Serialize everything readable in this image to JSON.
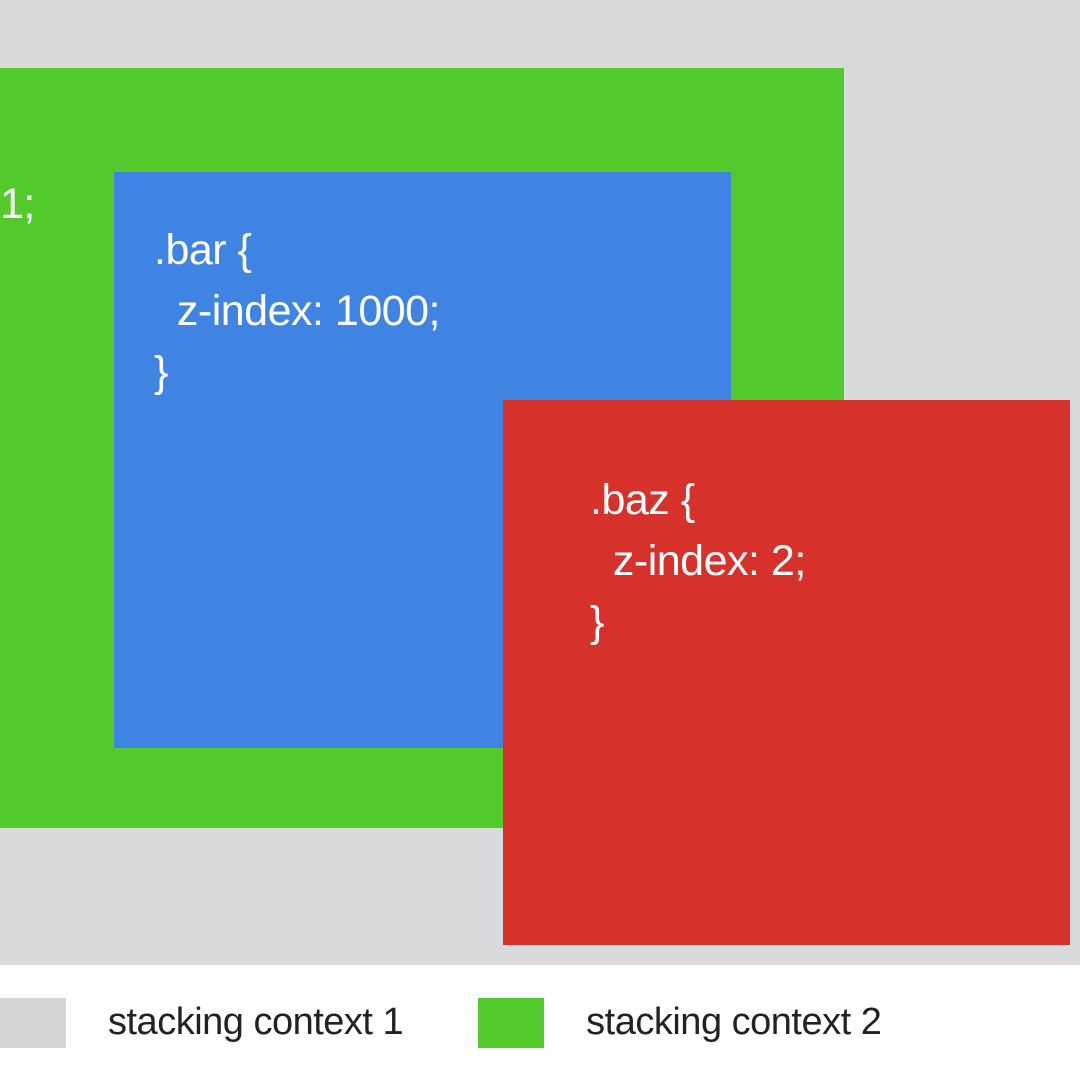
{
  "colors": {
    "bg": "#d9dadb",
    "green": "#52ca2c",
    "blue": "#4084e3",
    "red": "#d6312a",
    "swatch_gray": "#d6d6d6"
  },
  "boxes": {
    "foo": {
      "visible_fragment": "1;"
    },
    "bar": {
      "selector": ".bar {",
      "rule": "  z-index: 1000;",
      "close": "}"
    },
    "baz": {
      "selector": ".baz {",
      "rule": "  z-index: 2;",
      "close": "}"
    }
  },
  "legend": {
    "items": [
      {
        "label": "stacking context 1",
        "swatch": "gray"
      },
      {
        "label": "stacking context 2",
        "swatch": "green"
      }
    ]
  }
}
